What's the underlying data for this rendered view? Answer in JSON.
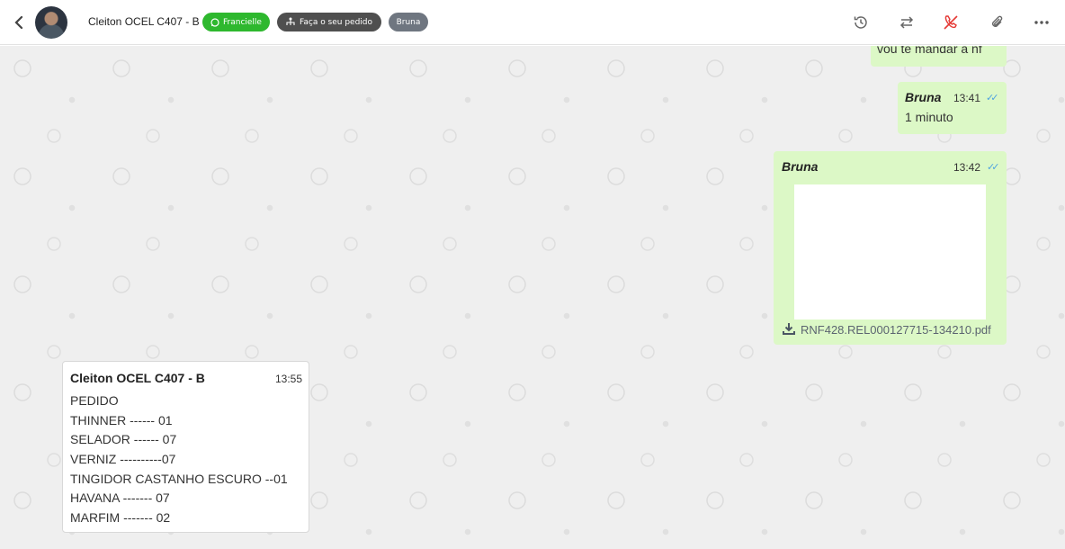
{
  "header": {
    "contact_name": "Cleiton OCEL C407 - B",
    "tags": {
      "connection": "Francielle",
      "flow": "Faça o seu pedido",
      "user": "Bruna"
    },
    "colors": {
      "connection_tag": "#2eb82e",
      "flow_tag": "#4f4f4f",
      "user_tag": "#6f7680",
      "end_call": "#e53935"
    },
    "icons": [
      "back-arrow-icon",
      "history-icon",
      "transfer-icon",
      "end-call-icon",
      "paperclip-icon",
      "more-options-icon"
    ]
  },
  "messages": [
    {
      "id": "partial",
      "text": "vou te mandar a nf"
    },
    {
      "id": "one-minute",
      "sender": "Bruna",
      "time": "13:41",
      "text": "1 minuto"
    },
    {
      "id": "file",
      "sender": "Bruna",
      "time": "13:42",
      "file_name": "RNF428.REL000127715-134210.pdf"
    },
    {
      "id": "order",
      "sender": "Cleiton OCEL C407 - B",
      "time": "13:55",
      "lines": [
        "PEDIDO",
        "THINNER ------ 01",
        "SELADOR ------ 07",
        "VERNIZ ----------07",
        "TINGIDOR CASTANHO ESCURO --01",
        "HAVANA ------- 07",
        "MARFIM ------- 02"
      ]
    }
  ],
  "colors": {
    "outgoing_bubble": "#dcf8c6",
    "incoming_bubble": "#ffffff",
    "read_ticks": "#4fa3e0",
    "chat_bg": "#efefef"
  }
}
